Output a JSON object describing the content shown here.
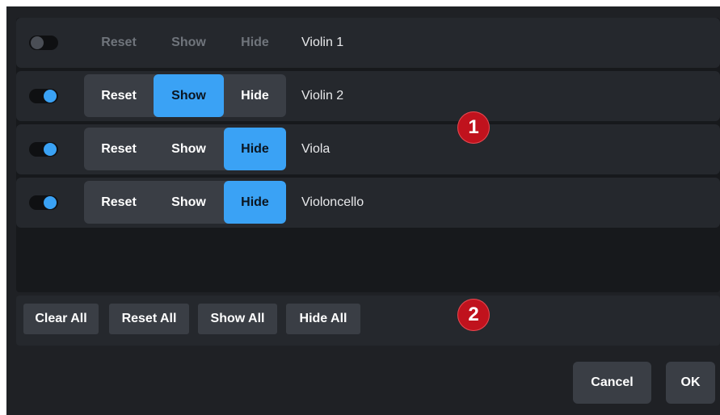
{
  "instruments": [
    {
      "name": "Violin 1",
      "enabled": false,
      "selected": "none",
      "reset_label": "Reset",
      "show_label": "Show",
      "hide_label": "Hide"
    },
    {
      "name": "Violin 2",
      "enabled": true,
      "selected": "show",
      "reset_label": "Reset",
      "show_label": "Show",
      "hide_label": "Hide"
    },
    {
      "name": "Viola",
      "enabled": true,
      "selected": "hide",
      "reset_label": "Reset",
      "show_label": "Show",
      "hide_label": "Hide"
    },
    {
      "name": "Violoncello",
      "enabled": true,
      "selected": "hide",
      "reset_label": "Reset",
      "show_label": "Show",
      "hide_label": "Hide"
    }
  ],
  "callouts": {
    "one": "1",
    "two": "2"
  },
  "bulk_actions": {
    "clear_all": "Clear All",
    "reset_all": "Reset All",
    "show_all": "Show All",
    "hide_all": "Hide All"
  },
  "dialog": {
    "cancel": "Cancel",
    "ok": "OK"
  },
  "colors": {
    "accent": "#3aa2f5",
    "callout": "#c0121d",
    "dialog_bg": "#1f2125",
    "row_bg": "#25282d"
  }
}
